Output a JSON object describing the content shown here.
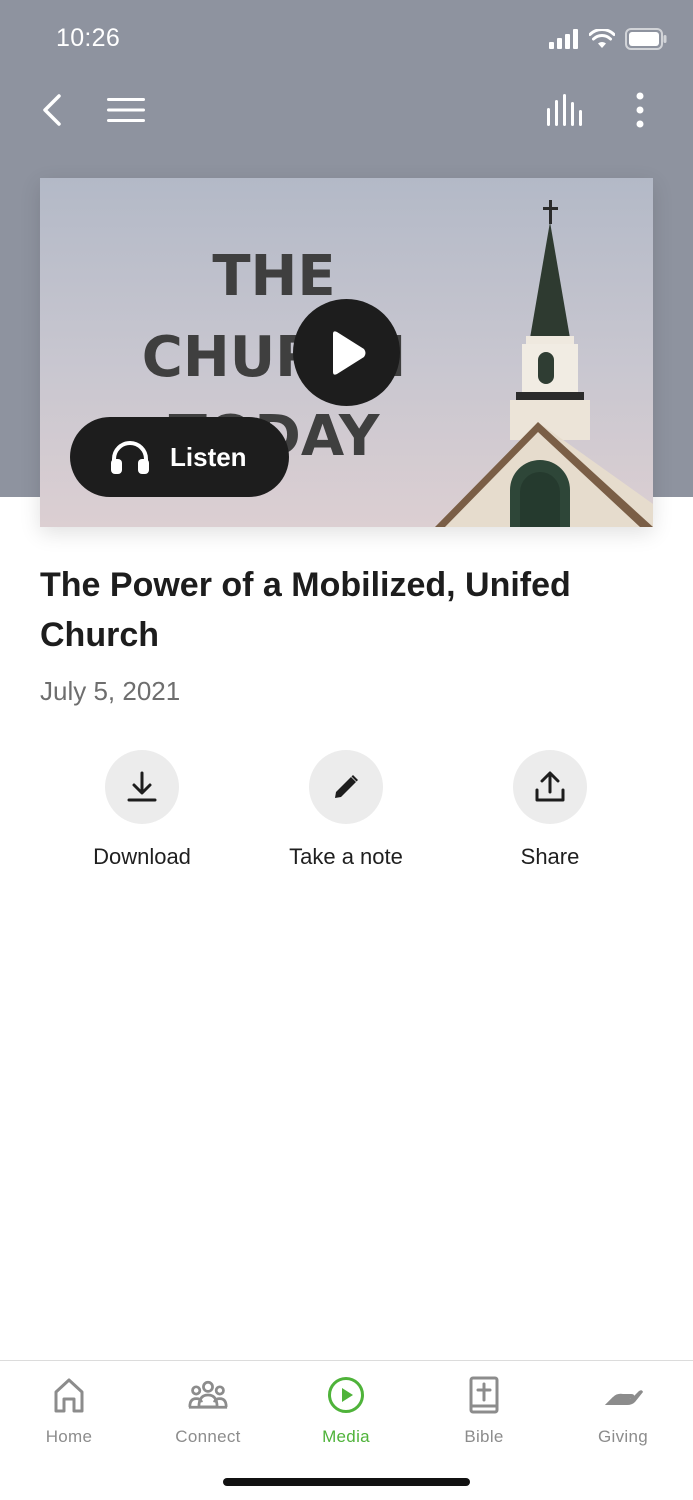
{
  "status_bar": {
    "time": "10:26"
  },
  "artwork": {
    "line1": "THE",
    "line2": "CHURCH",
    "line3": "TODAY"
  },
  "listen_button": {
    "label": "Listen"
  },
  "sermon": {
    "title": "The Power of a Mobilized, Unifed Church",
    "date": "July 5, 2021"
  },
  "actions": [
    {
      "label": "Download",
      "icon": "download-icon"
    },
    {
      "label": "Take a note",
      "icon": "pencil-icon"
    },
    {
      "label": "Share",
      "icon": "share-icon"
    }
  ],
  "tabs": [
    {
      "label": "Home",
      "icon": "home-icon",
      "active": false
    },
    {
      "label": "Connect",
      "icon": "people-icon",
      "active": false
    },
    {
      "label": "Media",
      "icon": "play-circle-icon",
      "active": true
    },
    {
      "label": "Bible",
      "icon": "bible-icon",
      "active": false
    },
    {
      "label": "Giving",
      "icon": "giving-hand-icon",
      "active": false
    }
  ],
  "colors": {
    "hero_background": "#8e939f",
    "accent": "#4fb33a",
    "inactive_tab": "#8c8c8c",
    "button_dark": "#1d1d1d"
  }
}
